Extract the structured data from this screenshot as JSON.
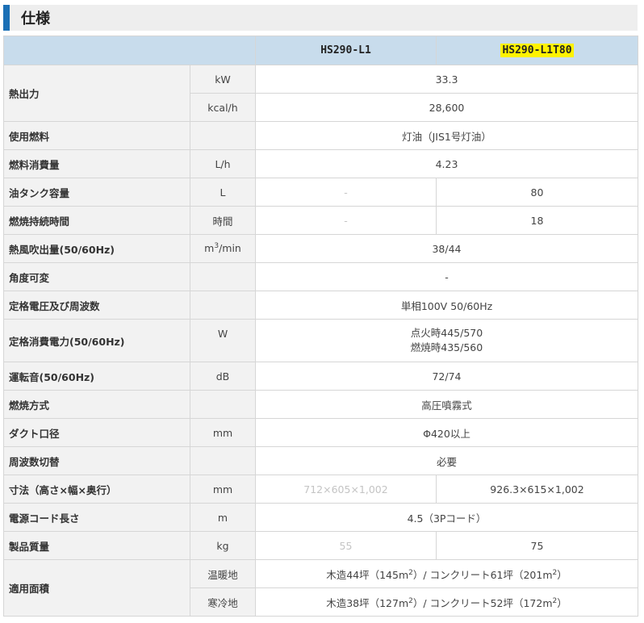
{
  "title": "仕様",
  "models": [
    "HS290-L1",
    "HS290-L1T80"
  ],
  "rows": {
    "heat_kw": {
      "label": "熱出力",
      "unit": "kW",
      "value": "33.3"
    },
    "heat_kcal": {
      "unit": "kcal/h",
      "value": "28,600"
    },
    "fuel": {
      "label": "使用燃料",
      "value": "灯油（JIS1号灯油）"
    },
    "fuel_consumption": {
      "label": "燃料消費量",
      "unit": "L/h",
      "value": "4.23"
    },
    "tank": {
      "label": "油タンク容量",
      "unit": "L",
      "v1": "-",
      "v2": "80"
    },
    "burn_time": {
      "label": "燃焼持続時間",
      "unit": "時間",
      "v1": "-",
      "v2": "18"
    },
    "airflow": {
      "label": "熱風吹出量(50/60Hz)",
      "unit_base": "m",
      "unit_sup": "3",
      "unit_rest": "/min",
      "value": "38/44"
    },
    "angle": {
      "label": "角度可変",
      "value": "-"
    },
    "voltage": {
      "label": "定格電圧及び周波数",
      "value": "単相100V 50/60Hz"
    },
    "power": {
      "label": "定格消費電力(50/60Hz)",
      "unit": "W",
      "line1": "点火時445/570",
      "line2": "燃焼時435/560"
    },
    "noise": {
      "label": "運転音(50/60Hz)",
      "unit": "dB",
      "value": "72/74"
    },
    "combustion": {
      "label": "燃焼方式",
      "value": "高圧噴霧式"
    },
    "duct": {
      "label": "ダクト口径",
      "unit": "mm",
      "value": "Φ420以上"
    },
    "freq_switch": {
      "label": "周波数切替",
      "value": "必要"
    },
    "dimensions": {
      "label": "寸法（高さ×幅×奥行）",
      "unit": "mm",
      "v1": "712×605×1,002",
      "v2": "926.3×615×1,002"
    },
    "cord": {
      "label": "電源コード長さ",
      "unit": "m",
      "value": "4.5（3Pコード）"
    },
    "weight": {
      "label": "製品質量",
      "unit": "kg",
      "v1": "55",
      "v2": "75"
    },
    "area": {
      "label": "適用面積",
      "warm": {
        "unit": "温暖地",
        "a": "木造44坪（145m",
        "b": "）/ コンクリート61坪（201m",
        "c": "）",
        "sup": "2"
      },
      "cold": {
        "unit": "寒冷地",
        "a": "木造38坪（127m",
        "b": "）/ コンクリート52坪（172m",
        "c": "）",
        "sup": "2"
      }
    }
  },
  "colors": {
    "accent": "#1a6fb5",
    "header_bg": "#c8dcec",
    "label_bg": "#f2f2f2",
    "highlight": "#fff200"
  }
}
